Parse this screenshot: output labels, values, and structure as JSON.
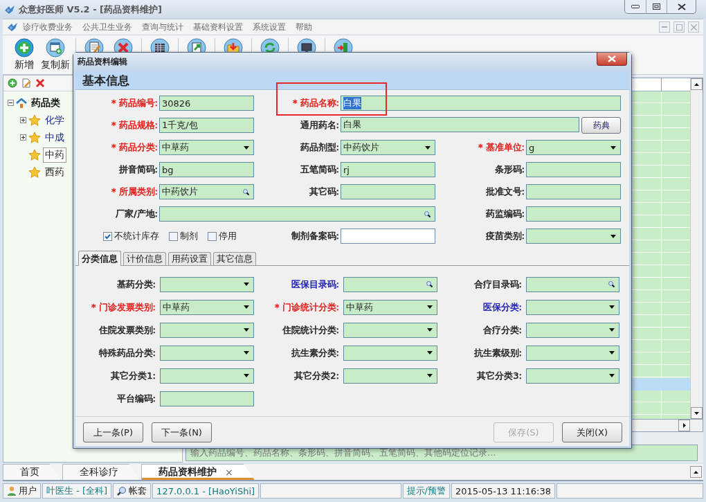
{
  "window": {
    "title": "众意好医师 V5.2 - [药品资料维护]"
  },
  "menu": [
    "诊疗收费业务",
    "公共卫生业务",
    "查询与统计",
    "基础资料设置",
    "系统设置",
    "帮助"
  ],
  "toolbar": [
    {
      "kind": "add",
      "label": "新增"
    },
    {
      "kind": "copy",
      "label": "复制新"
    },
    {
      "kind": "edit"
    },
    {
      "kind": "delete"
    },
    {
      "kind": "grid"
    },
    {
      "kind": "export"
    },
    {
      "kind": "import"
    },
    {
      "kind": "refresh"
    },
    {
      "kind": "monitor"
    },
    {
      "kind": "exit"
    }
  ],
  "tree": {
    "label": "药品类",
    "expanded": true,
    "children": [
      {
        "label": "化学",
        "kind": "folder",
        "expanded": false,
        "selected": false
      },
      {
        "label": "中成",
        "kind": "folder",
        "expanded": false,
        "selected": false
      },
      {
        "label": "中药",
        "kind": "leaf",
        "selected": true
      },
      {
        "label": "西药",
        "kind": "leaf",
        "selected": false
      }
    ]
  },
  "search_field": {
    "placeholder": "输入药品编号、药品名称、条形码、拼音简码、五笔简码、其他码定位记录..."
  },
  "dialog": {
    "title": "药品资料编辑",
    "section": "基本信息",
    "basic_rows": [
      [
        {
          "label": "* 药品编号:",
          "color": "#e0201c",
          "kind": "text",
          "value": "30826"
        },
        {
          "label": "* 药品名称:",
          "color": "#e0201c",
          "kind": "wide-text",
          "value": "白果",
          "text_selected": true,
          "callout": true
        }
      ],
      [
        {
          "label": "* 药品规格:",
          "color": "#e0201c",
          "kind": "text",
          "value": "1千克/包"
        },
        {
          "label": "通用药名:",
          "color": "#222222",
          "kind": "wide-text",
          "value": "白果",
          "button": "药典"
        }
      ],
      [
        {
          "label": "* 药品分类:",
          "color": "#e0201c",
          "kind": "dropdown",
          "value": "中草药"
        },
        {
          "label": "药品剂型:",
          "color": "#222222",
          "kind": "dropdown",
          "value": "中药饮片"
        },
        {
          "label": "* 基准单位:",
          "color": "#e0201c",
          "kind": "dropdown",
          "value": "g"
        }
      ],
      [
        {
          "label": "拼音简码:",
          "color": "#222222",
          "kind": "text",
          "value": "bg"
        },
        {
          "label": "五笔简码:",
          "color": "#222222",
          "kind": "text",
          "value": "rj"
        },
        {
          "label": "条形码:",
          "color": "#222222",
          "kind": "text"
        }
      ],
      [
        {
          "label": "* 所属类别:",
          "color": "#e0201c",
          "kind": "lookup",
          "value": "中药饮片"
        },
        {
          "label": "其它码:",
          "color": "#222222",
          "kind": "text"
        },
        {
          "label": "批准文号:",
          "color": "#222222",
          "kind": "text"
        }
      ],
      [
        {
          "label": "厂家/产地:",
          "color": "#222222",
          "kind": "wide-lookup"
        },
        {
          "label": "药监编码:",
          "color": "#222222",
          "kind": "text"
        }
      ],
      [
        {
          "kind": "checks",
          "items": [
            {
              "label": "不统计库存",
              "checked": true
            },
            {
              "label": "制剂",
              "checked": false
            },
            {
              "label": "停用",
              "checked": false
            }
          ]
        },
        {
          "label": "制剂备案码:",
          "color": "#222222",
          "kind": "white"
        },
        {
          "label": "疫苗类别:",
          "color": "#222222",
          "kind": "dropdown"
        }
      ]
    ],
    "tabs": [
      {
        "label": "分类信息",
        "selected": true
      },
      {
        "label": "计价信息",
        "selected": false
      },
      {
        "label": "用药设置",
        "selected": false
      },
      {
        "label": "其它信息",
        "selected": false
      }
    ],
    "tab_rows": [
      [
        {
          "label": "基药分类:",
          "color": "#222222",
          "kind": "dropdown"
        },
        {
          "label": "医保目录码:",
          "color": "#1a1ab4",
          "kind": "lookup"
        },
        {
          "label": "合疗目录码:",
          "color": "#222222",
          "kind": "lookup"
        }
      ],
      [
        {
          "label": "* 门诊发票类别:",
          "color": "#e0201c",
          "kind": "dropdown",
          "value": "中草药"
        },
        {
          "label": "* 门诊统计分类:",
          "color": "#e0201c",
          "kind": "dropdown",
          "value": "中草药"
        },
        {
          "label": "医保分类:",
          "color": "#1a1ab4",
          "kind": "dropdown"
        }
      ],
      [
        {
          "label": "住院发票类别:",
          "color": "#222222",
          "kind": "dropdown"
        },
        {
          "label": "住院统计分类:",
          "color": "#222222",
          "kind": "dropdown"
        },
        {
          "label": "合疗分类:",
          "color": "#222222",
          "kind": "dropdown"
        }
      ],
      [
        {
          "label": "特殊药品分类:",
          "color": "#222222",
          "kind": "dropdown"
        },
        {
          "label": "抗生素分类:",
          "color": "#222222",
          "kind": "dropdown"
        },
        {
          "label": "抗生素级别:",
          "color": "#222222",
          "kind": "dropdown"
        }
      ],
      [
        {
          "label": "其它分类1:",
          "color": "#222222",
          "kind": "dropdown"
        },
        {
          "label": "其它分类2:",
          "color": "#222222",
          "kind": "dropdown"
        },
        {
          "label": "其它分类3:",
          "color": "#222222",
          "kind": "dropdown"
        }
      ],
      [
        {
          "label": "平台编码:",
          "color": "#222222",
          "kind": "text"
        }
      ]
    ],
    "buttons": [
      {
        "label": "上一条(P)",
        "disabled": false
      },
      {
        "label": "下一条(N)",
        "disabled": false
      },
      {
        "label": "保存(S)",
        "disabled": true
      },
      {
        "label": "关闭(X)",
        "disabled": false
      }
    ]
  },
  "bottom_tabs": [
    {
      "label": "首页",
      "selected": false
    },
    {
      "label": "全科诊疗",
      "selected": false
    },
    {
      "label": "药品资料维护",
      "selected": true,
      "close": "×"
    }
  ],
  "status_bar": [
    {
      "kind": "user",
      "label": "用户"
    },
    {
      "kind": "info",
      "label": "叶医生 - [全科]"
    },
    {
      "kind": "account",
      "label": "帐套"
    },
    {
      "kind": "info",
      "label": "127.0.0.1 - [HaoYiShi]"
    },
    {
      "kind": "alert",
      "label": "提示/预警"
    },
    {
      "kind": "time",
      "label": "2015-05-13 11:16:38"
    }
  ]
}
